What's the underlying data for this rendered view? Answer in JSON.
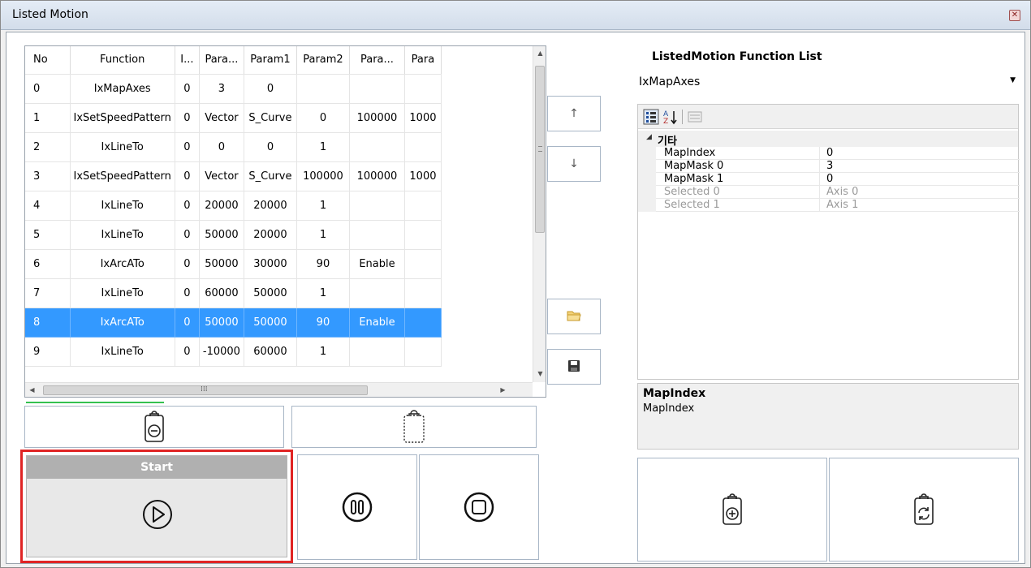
{
  "window": {
    "title": "Listed Motion"
  },
  "grid": {
    "columns": [
      "No",
      "Function",
      "I...",
      "Para...",
      "Param1",
      "Param2",
      "Para...",
      "Para"
    ],
    "rows": [
      [
        "0",
        "IxMapAxes",
        "0",
        "3",
        "0",
        "",
        "",
        ""
      ],
      [
        "1",
        "IxSetSpeedPattern",
        "0",
        "Vector",
        "S_Curve",
        "0",
        "100000",
        "1000"
      ],
      [
        "2",
        "IxLineTo",
        "0",
        "0",
        "0",
        "1",
        "",
        ""
      ],
      [
        "3",
        "IxSetSpeedPattern",
        "0",
        "Vector",
        "S_Curve",
        "100000",
        "100000",
        "1000"
      ],
      [
        "4",
        "IxLineTo",
        "0",
        "20000",
        "20000",
        "1",
        "",
        ""
      ],
      [
        "5",
        "IxLineTo",
        "0",
        "50000",
        "20000",
        "1",
        "",
        ""
      ],
      [
        "6",
        "IxArcATo",
        "0",
        "50000",
        "30000",
        "90",
        "Enable",
        ""
      ],
      [
        "7",
        "IxLineTo",
        "0",
        "60000",
        "50000",
        "1",
        "",
        ""
      ],
      [
        "8",
        "IxArcATo",
        "0",
        "50000",
        "50000",
        "90",
        "Enable",
        ""
      ],
      [
        "9",
        "IxLineTo",
        "0",
        "-10000",
        "60000",
        "1",
        "",
        ""
      ]
    ],
    "selected_row": 8
  },
  "buttons": {
    "move_up": "↑",
    "move_down": "↓",
    "start_label": "Start"
  },
  "function_list": {
    "title": "ListedMotion Function List",
    "selected": "IxMapAxes"
  },
  "property_grid": {
    "category": "기타",
    "properties": [
      {
        "name": "MapIndex",
        "value": "0",
        "readonly": false
      },
      {
        "name": "MapMask 0",
        "value": "3",
        "readonly": false
      },
      {
        "name": "MapMask 1",
        "value": "0",
        "readonly": false
      },
      {
        "name": "Selected 0",
        "value": "Axis 0",
        "readonly": true
      },
      {
        "name": "Selected 1",
        "value": "Axis 1",
        "readonly": true
      }
    ],
    "help_title": "MapIndex",
    "help_text": "MapIndex"
  },
  "icons": {
    "close": "close-icon",
    "up": "arrow-up-icon",
    "down": "arrow-down-icon",
    "open": "folder-icon",
    "save": "save-icon",
    "remove": "clipboard-remove-icon",
    "clear": "clipboard-empty-icon",
    "play": "play-icon",
    "pause": "pause-icon",
    "stop": "stop-icon",
    "add": "clipboard-add-icon",
    "replace": "clipboard-replace-icon",
    "categorized": "categorized-icon",
    "alphabetical": "sort-alpha-icon",
    "pages": "property-pages-icon"
  },
  "colors": {
    "selection": "#3399ff",
    "highlight": "#e02424",
    "progress": "#35c150"
  }
}
